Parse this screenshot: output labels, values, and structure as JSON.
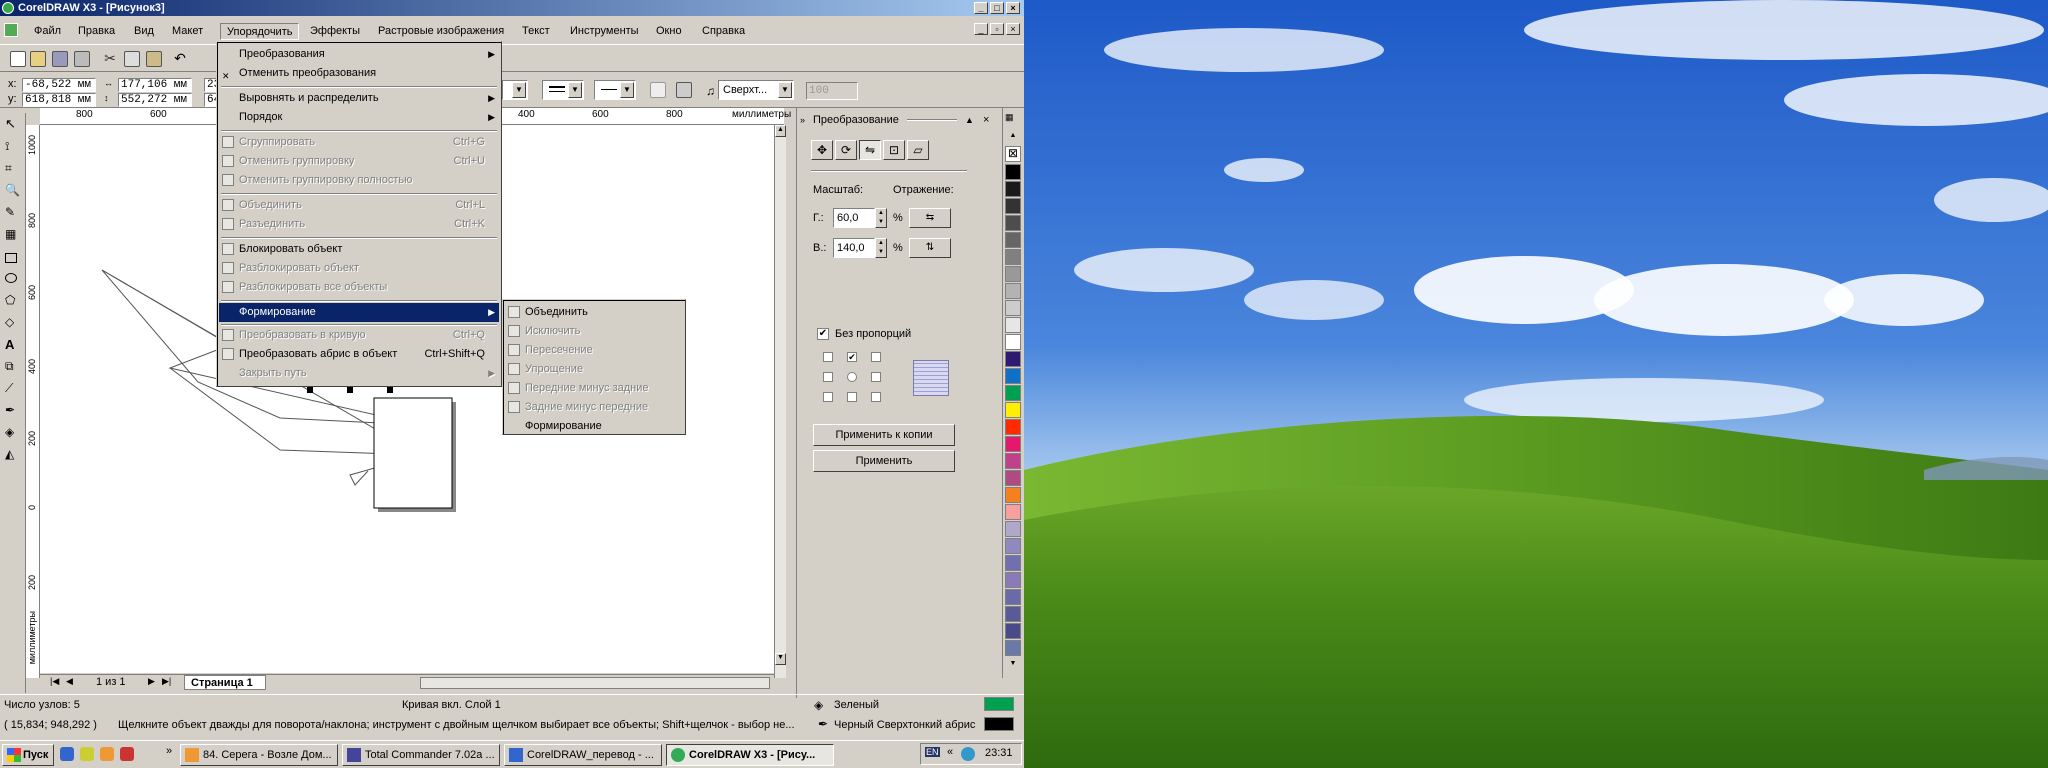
{
  "window": {
    "title": "CorelDRAW X3 - [Рисунок3]"
  },
  "menubar": {
    "items": [
      "Файл",
      "Правка",
      "Вид",
      "Макет",
      "Упорядочить",
      "Эффекты",
      "Растровые изображения",
      "Текст",
      "Инструменты",
      "Окно",
      "Справка"
    ]
  },
  "propbar": {
    "x_label": "x:",
    "x_value": "-68,522 мм",
    "y_label": "y:",
    "y_value": "618,818 мм",
    "w_value": "177,106 мм",
    "h_value": "552,272 мм",
    "partial1": "23",
    "partial2": "64",
    "wrap_combo": "Сверхт...",
    "percent": "100"
  },
  "ruler": {
    "h_ticks": [
      "800",
      "600",
      "400",
      "600",
      "800"
    ],
    "h_unit": "миллиметры",
    "v_ticks": [
      "1000",
      "800",
      "600",
      "400",
      "200",
      "0",
      "200"
    ],
    "v_unit": "миллиметры"
  },
  "arrange_menu": {
    "items": [
      {
        "label": "Преобразования",
        "shortcut": "",
        "submenu": true,
        "disabled": false
      },
      {
        "label": "Отменить преобразования",
        "shortcut": "",
        "disabled": false
      },
      {
        "label": "Выровнять и распределить",
        "shortcut": "",
        "submenu": true,
        "disabled": false
      },
      {
        "label": "Порядок",
        "shortcut": "",
        "submenu": true,
        "disabled": false
      },
      {
        "label": "Сгруппировать",
        "shortcut": "Ctrl+G",
        "disabled": true
      },
      {
        "label": "Отменить группировку",
        "shortcut": "Ctrl+U",
        "disabled": true
      },
      {
        "label": "Отменить группировку полностью",
        "shortcut": "",
        "disabled": true
      },
      {
        "label": "Объединить",
        "shortcut": "Ctrl+L",
        "disabled": true
      },
      {
        "label": "Разъединить",
        "shortcut": "Ctrl+K",
        "disabled": true
      },
      {
        "label": "Блокировать объект",
        "shortcut": "",
        "disabled": false
      },
      {
        "label": "Разблокировать объект",
        "shortcut": "",
        "disabled": true
      },
      {
        "label": "Разблокировать все объекты",
        "shortcut": "",
        "disabled": true
      },
      {
        "label": "Формирование",
        "shortcut": "",
        "submenu": true,
        "highlighted": true
      },
      {
        "label": "Преобразовать в кривую",
        "shortcut": "Ctrl+Q",
        "disabled": true
      },
      {
        "label": "Преобразовать абрис в объект",
        "shortcut": "Ctrl+Shift+Q",
        "disabled": false
      },
      {
        "label": "Закрыть путь",
        "shortcut": "",
        "submenu": true,
        "disabled": true
      }
    ]
  },
  "shaping_submenu": {
    "items": [
      {
        "label": "Объединить",
        "disabled": false
      },
      {
        "label": "Исключить",
        "disabled": true
      },
      {
        "label": "Пересечение",
        "disabled": true
      },
      {
        "label": "Упрощение",
        "disabled": true
      },
      {
        "label": "Передние минус задние",
        "disabled": true
      },
      {
        "label": "Задние минус передние",
        "disabled": true
      },
      {
        "label": "Формирование",
        "disabled": false
      }
    ]
  },
  "docker": {
    "title": "Преобразование",
    "scale_label": "Масштаб:",
    "mirror_label": "Отражение:",
    "h_label": "Г.:",
    "h_value": "60,0",
    "v_label": "В.:",
    "v_value": "140,0",
    "percent": "%",
    "nonprop_label": "Без пропорций",
    "apply_copy": "Применить к копии",
    "apply": "Применить"
  },
  "pages": {
    "counter": "1 из 1",
    "tab": "Страница 1"
  },
  "status": {
    "nodes": "Число узлов: 5",
    "layer": "Кривая вкл. Слой 1",
    "fill_name": "Зеленый",
    "coords": "( 15,834; 948,292 )",
    "hint": "Щелкните объект дважды для поворота/наклона; инструмент с двойным щелчком выбирает все объекты; Shift+щелчок - выбор не...",
    "outline": "Черный  Сверхтонкий абрис"
  },
  "taskbar": {
    "start": "Пуск",
    "tasks": [
      "84. Серега - Возле Дом...",
      "Total Commander 7.02a ...",
      "CorelDRAW_перевод - ...",
      "CorelDRAW X3 - [Рису..."
    ],
    "lang": "EN",
    "time": "23:31"
  },
  "colors": {
    "accent": "#0a246a",
    "fill_swatch": "#00a050",
    "outline_swatch": "#000000"
  }
}
